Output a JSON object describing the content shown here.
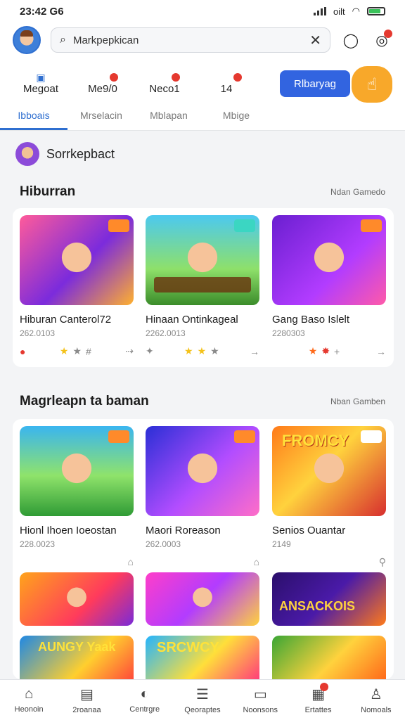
{
  "status": {
    "time": "23:42 G6",
    "network": "oilt"
  },
  "header": {
    "search_value": "Markpepkican"
  },
  "shortcuts": [
    {
      "label": "Megoat"
    },
    {
      "label": "Me9/0"
    },
    {
      "label": "Neco1"
    },
    {
      "label": "14"
    }
  ],
  "cta": {
    "label": "Rlbaryag"
  },
  "tabs": [
    "Ibboais",
    "Mrselacin",
    "Mblapan",
    "Mbige"
  ],
  "profile_row": {
    "name": "Sorrkepbact"
  },
  "section1": {
    "title": "Hiburran",
    "link": "Ndan Gamedo",
    "cards": [
      {
        "name": "Hiburan Canterol72",
        "meta": "262.0103"
      },
      {
        "name": "Hinaan Ontinkageal",
        "meta": "2262.0013"
      },
      {
        "name": "Gang Baso Islelt",
        "meta": "2280303"
      }
    ]
  },
  "section2": {
    "title": "Magrleapn ta baman",
    "link": "Nban Gamben",
    "cards": [
      {
        "name": "Hionl Ihoen Ioeostan",
        "meta": "228.0023"
      },
      {
        "name": "Maori Roreason",
        "meta": "262.0003"
      },
      {
        "name": "Senios Ouantar",
        "meta": "2149"
      }
    ]
  },
  "thumb_text": [
    "AUNGY Yaak",
    "SRCWCY",
    "ANSACKOIS",
    "FROMCY"
  ],
  "nav": [
    "Heonoin",
    "2roanaa",
    "Centrgre",
    "Qeoraptes",
    "Noonsons",
    "Ertattes",
    "Nomoals"
  ],
  "colors": {
    "accent": "#3264e0",
    "orange": "#f8a82a",
    "badge": "#e5392f"
  }
}
